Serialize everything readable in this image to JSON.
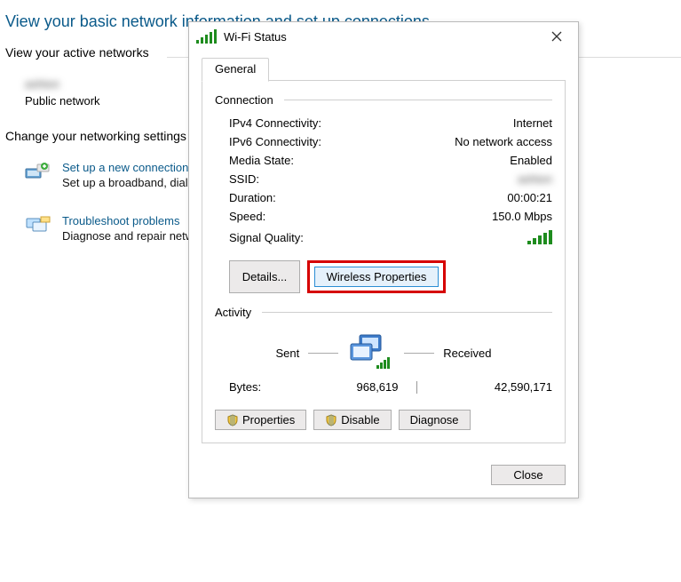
{
  "header": "View your basic network information and set up connections",
  "active_networks_heading": "View your active networks",
  "network": {
    "name_blurred": "ashton",
    "type": "Public network"
  },
  "change_settings_heading": "Change your networking settings",
  "links": {
    "setup": {
      "title": "Set up a new connection or network",
      "desc": "Set up a broadband, dial-up, or VPN connection; or set up a router or access point."
    },
    "troubleshoot": {
      "title": "Troubleshoot problems",
      "desc": "Diagnose and repair network problems, or get troubleshooting information."
    }
  },
  "dialog": {
    "title": "Wi-Fi Status",
    "tab": "General",
    "groups": {
      "connection": "Connection",
      "activity": "Activity"
    },
    "conn": {
      "ipv4_l": "IPv4 Connectivity:",
      "ipv4_v": "Internet",
      "ipv6_l": "IPv6 Connectivity:",
      "ipv6_v": "No network access",
      "media_l": "Media State:",
      "media_v": "Enabled",
      "ssid_l": "SSID:",
      "ssid_v_blurred": "ashton",
      "dur_l": "Duration:",
      "dur_v": "00:00:21",
      "speed_l": "Speed:",
      "speed_v": "150.0 Mbps",
      "signal_l": "Signal Quality:"
    },
    "buttons": {
      "details": "Details...",
      "wireless_props": "Wireless Properties",
      "properties": "Properties",
      "disable": "Disable",
      "diagnose": "Diagnose",
      "close": "Close"
    },
    "activity": {
      "sent_l": "Sent",
      "recv_l": "Received",
      "bytes_l": "Bytes:",
      "sent_v": "968,619",
      "recv_v": "42,590,171"
    }
  }
}
